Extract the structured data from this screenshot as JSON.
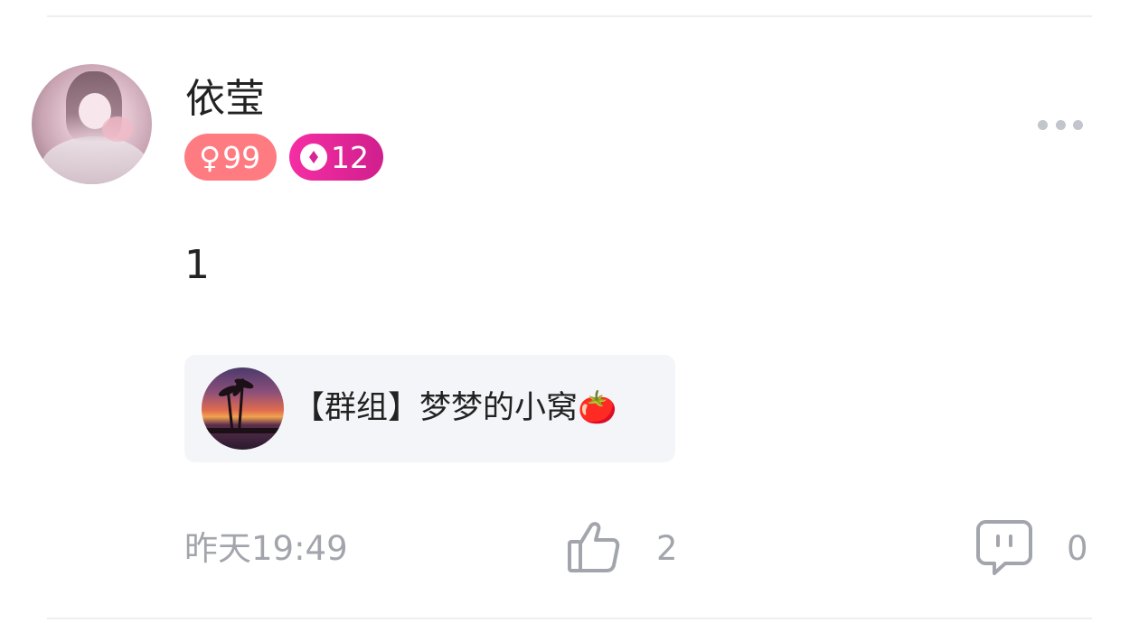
{
  "post": {
    "username": "依莹",
    "badges": {
      "gender_symbol": "♀",
      "gender_value": "99",
      "level_value": "12"
    },
    "content": "1",
    "group": {
      "name": "【群组】梦梦的小窝🍅"
    },
    "timestamp": "昨天19:49",
    "like_count": "2",
    "comment_count": "0"
  },
  "icons": {
    "more": "more-dots-icon",
    "like": "thumbs-up-icon",
    "comment": "comment-bubble-icon",
    "level": "diamond-icon"
  },
  "colors": {
    "gender_badge": "#ff7b82",
    "level_badge": "#e026a0",
    "text_primary": "#222222",
    "text_secondary": "#a3a5ad",
    "card_bg": "#f4f5f9"
  }
}
